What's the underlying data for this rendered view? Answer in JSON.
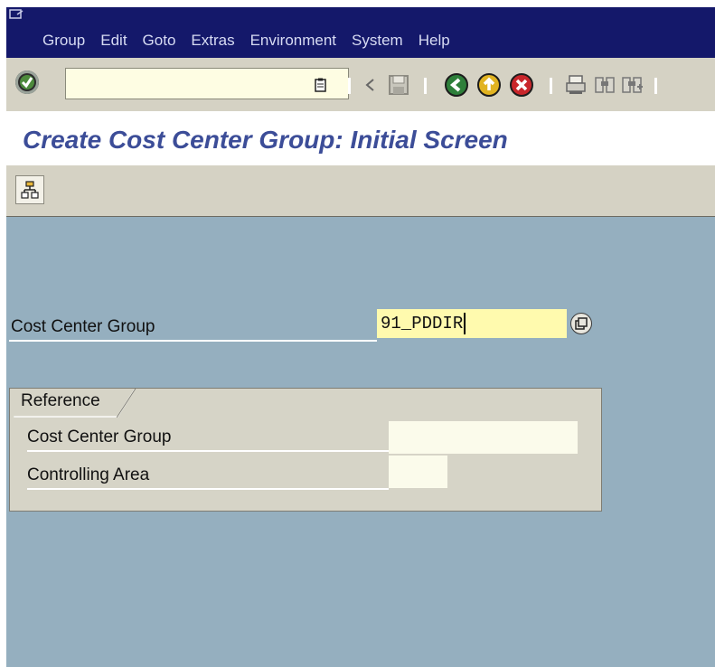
{
  "menubar": {
    "items": [
      "Group",
      "Edit",
      "Goto",
      "Extras",
      "Environment",
      "System",
      "Help"
    ]
  },
  "toolbar": {
    "command_value": "",
    "icons": [
      "enter-icon",
      "command-field-icon",
      "back-arrow-icon",
      "save-icon",
      "back-icon",
      "exit-icon",
      "cancel-icon",
      "print-icon",
      "find-icon",
      "find-next-icon"
    ]
  },
  "title": "Create Cost Center Group: Initial Screen",
  "app_toolbar": {
    "icons": [
      "hierarchy-icon"
    ]
  },
  "form": {
    "cost_center_group_label": "Cost Center Group",
    "cost_center_group_value": "91_PDDIR"
  },
  "reference": {
    "title": "Reference",
    "cost_center_group_label": "Cost Center Group",
    "cost_center_group_value": "",
    "controlling_area_label": "Controlling Area",
    "controlling_area_value": ""
  },
  "colors": {
    "menubar": "#14186a",
    "toolbar": "#d5d2c4",
    "title": "#3c4d98",
    "content": "#95afbf",
    "input_highlight": "#fffaae"
  }
}
